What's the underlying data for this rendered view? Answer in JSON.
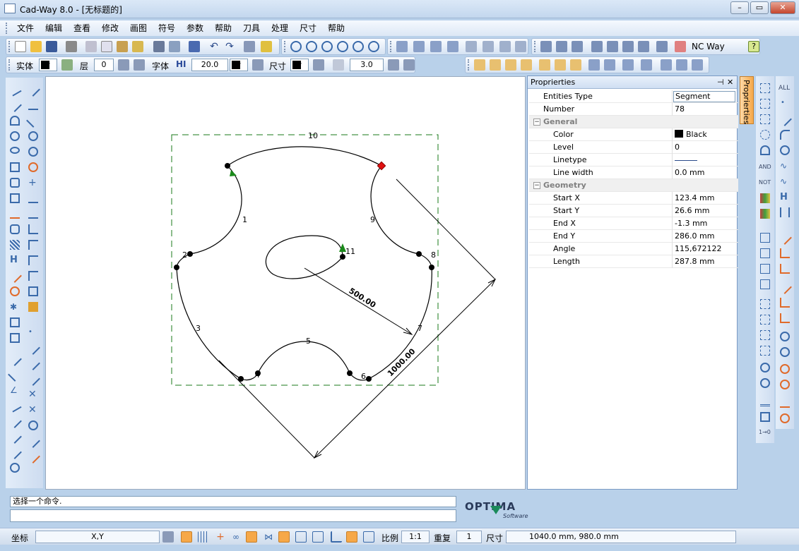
{
  "window": {
    "title": "Cad-Way 8.0 - [无标题的]"
  },
  "menu": [
    "文件",
    "编辑",
    "查看",
    "修改",
    "画图",
    "符号",
    "参数",
    "帮助",
    "刀具",
    "处理",
    "尺寸",
    "帮助"
  ],
  "toolbar": {
    "nc_way_label": "NC Way"
  },
  "attr_bar": {
    "entity_label": "实体",
    "layer_label": "层",
    "layer_value": "0",
    "font_label": "字体",
    "font_prefix": "HI",
    "font_size": "20.0",
    "dim_label": "尺寸",
    "dim_value": "3.0"
  },
  "drawing": {
    "labels": [
      "10",
      "1",
      "9",
      "2",
      "8",
      "11",
      "3",
      "7",
      "5",
      "6",
      "4"
    ],
    "dim_small": "500.00",
    "dim_large": "1000.00"
  },
  "properties": {
    "title": "Proprierties",
    "tab_label": "Proprierties",
    "rows": [
      {
        "k": "Entities Type",
        "v": "Segment",
        "type": "prop"
      },
      {
        "k": "Number",
        "v": "78",
        "type": "prop"
      },
      {
        "k": "General",
        "type": "cat"
      },
      {
        "k": "Color",
        "v": "Black",
        "type": "prop",
        "swatch": "#000000"
      },
      {
        "k": "Level",
        "v": "0",
        "type": "prop"
      },
      {
        "k": "Linetype",
        "v": "",
        "type": "linetype"
      },
      {
        "k": "Line width",
        "v": "0.0 mm",
        "type": "prop"
      },
      {
        "k": "Geometry",
        "type": "cat"
      },
      {
        "k": "Start X",
        "v": "123.4 mm",
        "type": "prop"
      },
      {
        "k": "Start Y",
        "v": "26.6 mm",
        "type": "prop"
      },
      {
        "k": "End X",
        "v": "-1.3 mm",
        "type": "prop"
      },
      {
        "k": "End Y",
        "v": "286.0 mm",
        "type": "prop"
      },
      {
        "k": "Angle",
        "v": "115,672122",
        "type": "prop"
      },
      {
        "k": "Length",
        "v": "287.8 mm",
        "type": "prop"
      }
    ]
  },
  "command": {
    "prompt": "选择一个命令.",
    "input": ""
  },
  "logo": {
    "text": "OPTIMA",
    "sub": "Software"
  },
  "status": {
    "coord_label": "坐标",
    "coord_mode": "X,Y",
    "scale_label": "比例",
    "scale_value": "1:1",
    "repeat_label": "重复",
    "repeat_value": "1",
    "size_label": "尺寸",
    "size_value": "1040.0 mm, 980.0 mm"
  },
  "right_panel_labels": {
    "all": "ALL",
    "and": "AND",
    "not": "NOT",
    "h": "H"
  },
  "colors": {
    "accent": "#f6a848",
    "frame": "#1a7a1a",
    "marker_red": "#e01010",
    "arrow_green": "#1a8a1a"
  }
}
